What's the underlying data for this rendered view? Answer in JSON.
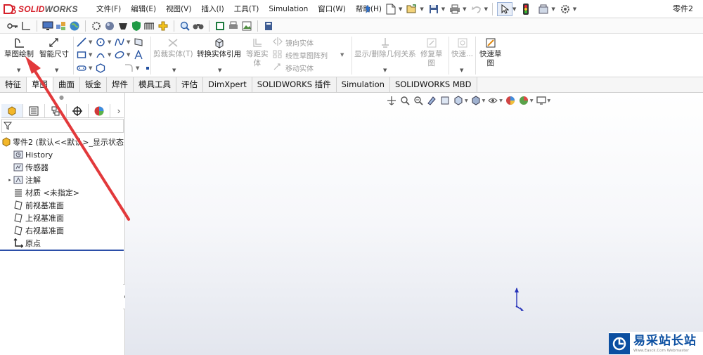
{
  "app": {
    "brand_ds": "DS",
    "brand_solid": "SOLID",
    "brand_works": "WORKS",
    "document_title": "零件2"
  },
  "menu": [
    "文件(F)",
    "编辑(E)",
    "视图(V)",
    "插入(I)",
    "工具(T)",
    "Simulation",
    "窗口(W)",
    "帮助(H)"
  ],
  "quick_access_icons": [
    "new-document-icon",
    "open-icon",
    "save-icon",
    "print-icon",
    "undo-icon",
    "select-arrow-icon",
    "traffic-light-icon",
    "rebuild-icon",
    "options-gear-icon"
  ],
  "ribbon": {
    "sketch": "草图绘制",
    "smart_dimension": "智能尺寸",
    "trim_entities": "剪裁实体(T)",
    "convert_entities": "转换实体引用",
    "offset_entities_line1": "等距实",
    "offset_entities_line2": "体",
    "mirror_entities": "镜向实体",
    "linear_pattern": "线性草图阵列",
    "move_entities": "移动实体",
    "display_relations": "显示/删除几何关系",
    "repair_sketch_line1": "修复草",
    "repair_sketch_line2": "图",
    "quick_snaps": "快速...",
    "rapid_sketch_line1": "快速草",
    "rapid_sketch_line2": "图"
  },
  "tabs": [
    {
      "label": "特征",
      "active": false
    },
    {
      "label": "草图",
      "active": true
    },
    {
      "label": "曲面",
      "active": false
    },
    {
      "label": "钣金",
      "active": false
    },
    {
      "label": "焊件",
      "active": false
    },
    {
      "label": "模具工具",
      "active": false
    },
    {
      "label": "评估",
      "active": false
    },
    {
      "label": "DimXpert",
      "active": false
    },
    {
      "label": "SOLIDWORKS 插件",
      "active": false
    },
    {
      "label": "Simulation",
      "active": false
    },
    {
      "label": "SOLIDWORKS MBD",
      "active": false
    }
  ],
  "feature_tree": {
    "root": "零件2  (默认<<默认>_显示状态",
    "items": [
      {
        "label": "History",
        "icon": "history-folder-icon"
      },
      {
        "label": "传感器",
        "icon": "sensor-folder-icon"
      },
      {
        "label": "注解",
        "icon": "annotation-icon",
        "expandable": true
      },
      {
        "label": "材质 <未指定>",
        "icon": "material-icon"
      },
      {
        "label": "前视基准面",
        "icon": "plane-icon"
      },
      {
        "label": "上视基准面",
        "icon": "plane-icon"
      },
      {
        "label": "右视基准面",
        "icon": "plane-icon"
      },
      {
        "label": "原点",
        "icon": "origin-icon"
      }
    ]
  },
  "watermark": {
    "cn": "易采站长站",
    "en": "Www.Easck.Com  Webmaster"
  },
  "colors": {
    "brand_red": "#d6202a",
    "annotation_red": "#e2393b",
    "rollback_blue": "#2b4ea8",
    "watermark_blue": "#0b4fa1"
  }
}
